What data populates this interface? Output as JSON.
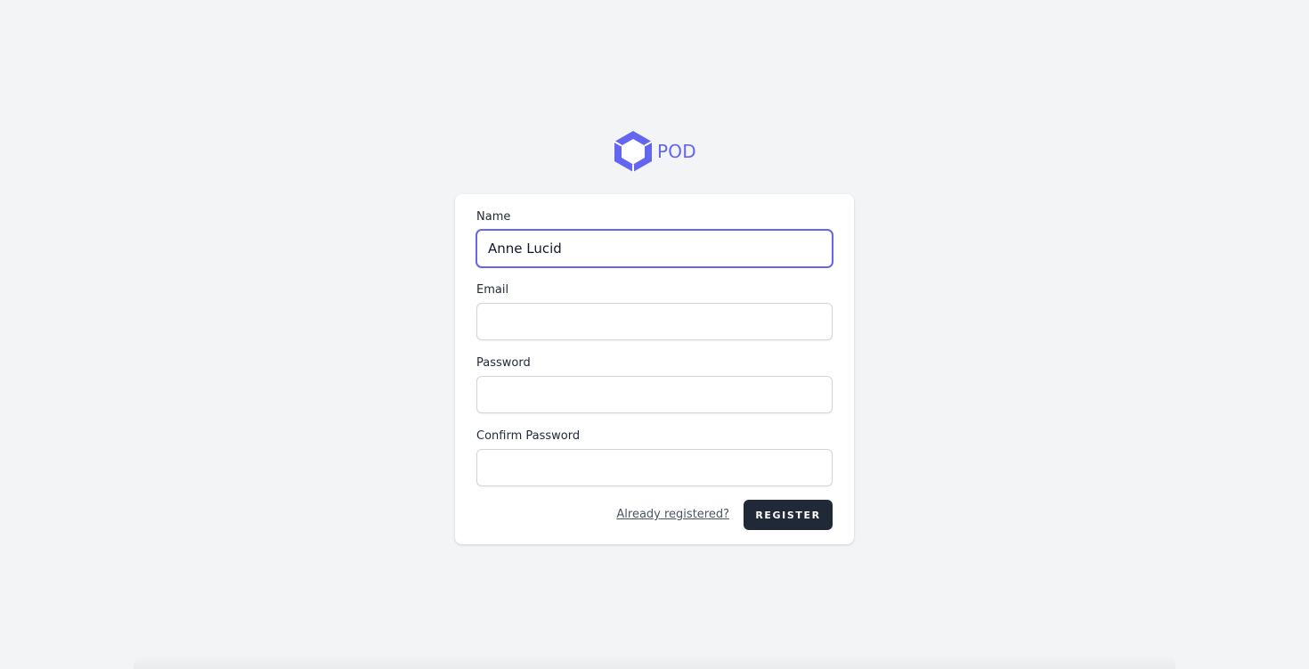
{
  "brand": {
    "name": "POD",
    "color": "#6366f1",
    "icon": "hexagon-cube-logo-icon"
  },
  "form": {
    "name": {
      "label": "Name",
      "value": "Anne Lucid",
      "placeholder": ""
    },
    "email": {
      "label": "Email",
      "value": "",
      "placeholder": ""
    },
    "password": {
      "label": "Password",
      "value": "",
      "placeholder": ""
    },
    "confirm_password": {
      "label": "Confirm Password",
      "value": "",
      "placeholder": ""
    },
    "already_registered_link": "Already registered?",
    "register_button": "REGISTER"
  },
  "colors": {
    "background": "#f3f4f6",
    "card": "#ffffff",
    "focus_ring": "#6366f1",
    "button": "#1f2937"
  }
}
